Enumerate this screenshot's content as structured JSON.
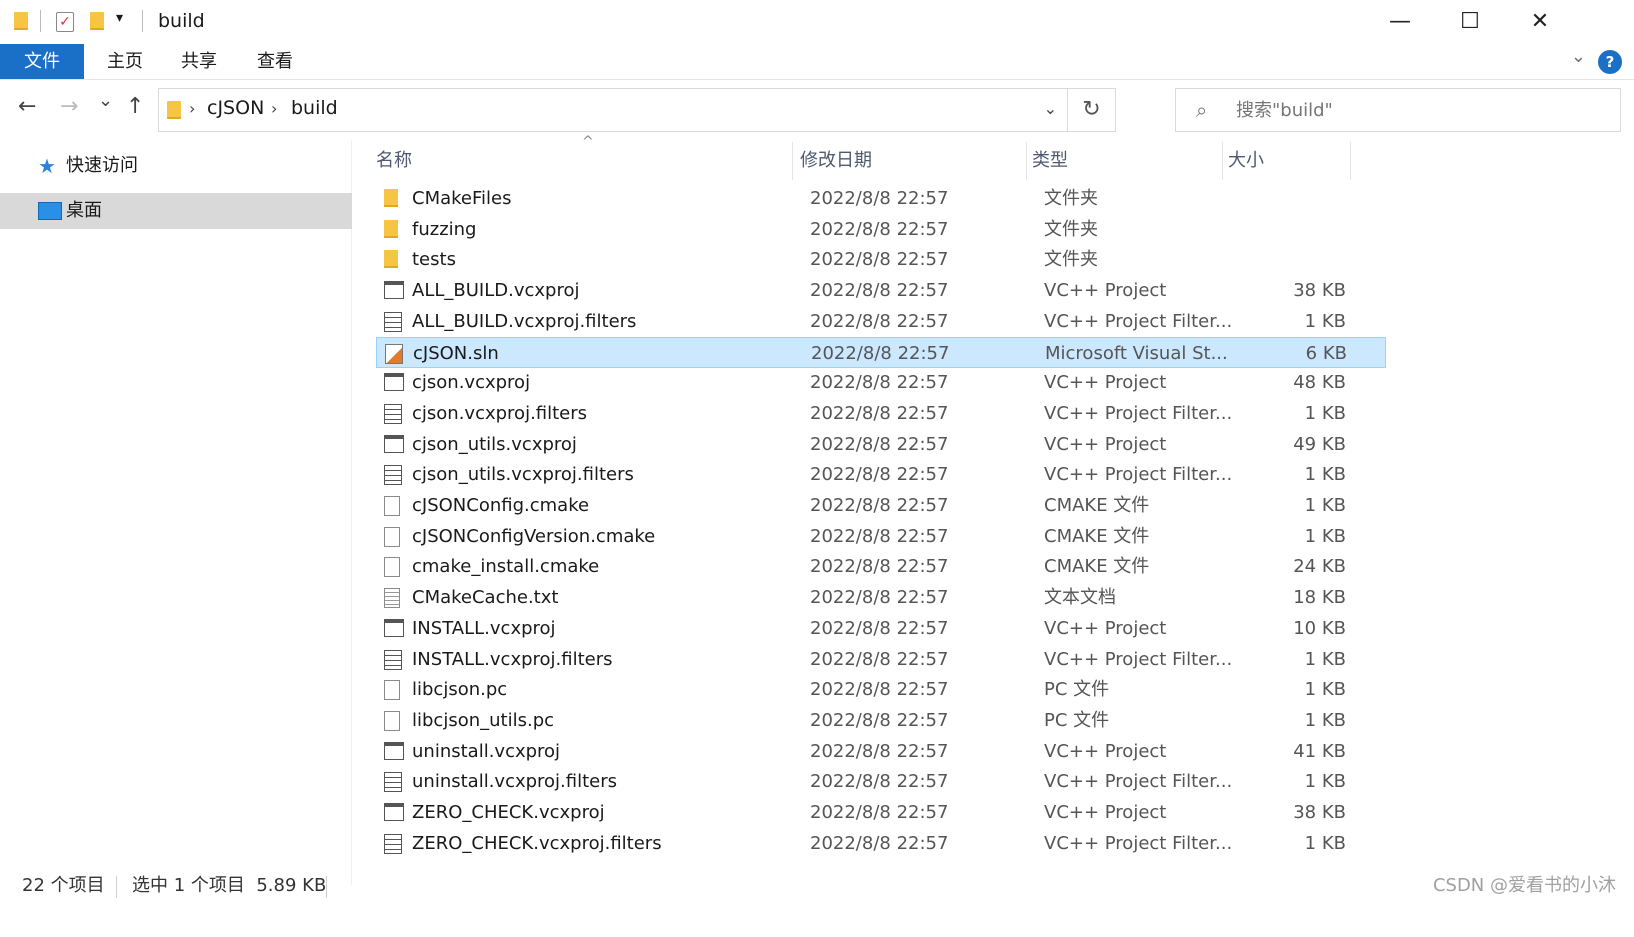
{
  "window": {
    "title": "build",
    "minimize": "—",
    "maximize": "☐",
    "close": "✕"
  },
  "ribbon": {
    "tabs": [
      "文件",
      "主页",
      "共享",
      "查看"
    ],
    "help": "?"
  },
  "nav": {
    "back": "←",
    "forward": "→",
    "recent": "⌄",
    "up": "↑"
  },
  "address": {
    "crumbs": [
      "cJSON",
      "build"
    ]
  },
  "search": {
    "placeholder": "搜索\"build\""
  },
  "sidebar": {
    "items": [
      {
        "label": "快速访问",
        "icon": "star-icon"
      },
      {
        "label": "桌面",
        "icon": "desktop-icon",
        "selected": true
      }
    ]
  },
  "columns": {
    "name": "名称",
    "date": "修改日期",
    "type": "类型",
    "size": "大小"
  },
  "files": [
    {
      "name": "CMakeFiles",
      "date": "2022/8/8 22:57",
      "type": "文件夹",
      "size": "",
      "icon": "folder-icon"
    },
    {
      "name": "fuzzing",
      "date": "2022/8/8 22:57",
      "type": "文件夹",
      "size": "",
      "icon": "folder-icon"
    },
    {
      "name": "tests",
      "date": "2022/8/8 22:57",
      "type": "文件夹",
      "size": "",
      "icon": "folder-icon"
    },
    {
      "name": "ALL_BUILD.vcxproj",
      "date": "2022/8/8 22:57",
      "type": "VC++ Project",
      "size": "38 KB",
      "icon": "vcxproj-icon"
    },
    {
      "name": "ALL_BUILD.vcxproj.filters",
      "date": "2022/8/8 22:57",
      "type": "VC++ Project Filter...",
      "size": "1 KB",
      "icon": "filters-icon"
    },
    {
      "name": "cJSON.sln",
      "date": "2022/8/8 22:57",
      "type": "Microsoft Visual St...",
      "size": "6 KB",
      "icon": "sln-icon",
      "selected": true
    },
    {
      "name": "cjson.vcxproj",
      "date": "2022/8/8 22:57",
      "type": "VC++ Project",
      "size": "48 KB",
      "icon": "vcxproj-icon"
    },
    {
      "name": "cjson.vcxproj.filters",
      "date": "2022/8/8 22:57",
      "type": "VC++ Project Filter...",
      "size": "1 KB",
      "icon": "filters-icon"
    },
    {
      "name": "cjson_utils.vcxproj",
      "date": "2022/8/8 22:57",
      "type": "VC++ Project",
      "size": "49 KB",
      "icon": "vcxproj-icon"
    },
    {
      "name": "cjson_utils.vcxproj.filters",
      "date": "2022/8/8 22:57",
      "type": "VC++ Project Filter...",
      "size": "1 KB",
      "icon": "filters-icon"
    },
    {
      "name": "cJSONConfig.cmake",
      "date": "2022/8/8 22:57",
      "type": "CMAKE 文件",
      "size": "1 KB",
      "icon": "file-icon"
    },
    {
      "name": "cJSONConfigVersion.cmake",
      "date": "2022/8/8 22:57",
      "type": "CMAKE 文件",
      "size": "1 KB",
      "icon": "file-icon"
    },
    {
      "name": "cmake_install.cmake",
      "date": "2022/8/8 22:57",
      "type": "CMAKE 文件",
      "size": "24 KB",
      "icon": "file-icon"
    },
    {
      "name": "CMakeCache.txt",
      "date": "2022/8/8 22:57",
      "type": "文本文档",
      "size": "18 KB",
      "icon": "text-file-icon"
    },
    {
      "name": "INSTALL.vcxproj",
      "date": "2022/8/8 22:57",
      "type": "VC++ Project",
      "size": "10 KB",
      "icon": "vcxproj-icon"
    },
    {
      "name": "INSTALL.vcxproj.filters",
      "date": "2022/8/8 22:57",
      "type": "VC++ Project Filter...",
      "size": "1 KB",
      "icon": "filters-icon"
    },
    {
      "name": "libcjson.pc",
      "date": "2022/8/8 22:57",
      "type": "PC 文件",
      "size": "1 KB",
      "icon": "file-icon"
    },
    {
      "name": "libcjson_utils.pc",
      "date": "2022/8/8 22:57",
      "type": "PC 文件",
      "size": "1 KB",
      "icon": "file-icon"
    },
    {
      "name": "uninstall.vcxproj",
      "date": "2022/8/8 22:57",
      "type": "VC++ Project",
      "size": "41 KB",
      "icon": "vcxproj-icon"
    },
    {
      "name": "uninstall.vcxproj.filters",
      "date": "2022/8/8 22:57",
      "type": "VC++ Project Filter...",
      "size": "1 KB",
      "icon": "filters-icon"
    },
    {
      "name": "ZERO_CHECK.vcxproj",
      "date": "2022/8/8 22:57",
      "type": "VC++ Project",
      "size": "38 KB",
      "icon": "vcxproj-icon"
    },
    {
      "name": "ZERO_CHECK.vcxproj.filters",
      "date": "2022/8/8 22:57",
      "type": "VC++ Project Filter...",
      "size": "1 KB",
      "icon": "filters-icon"
    }
  ],
  "status": {
    "count": "22 个项目",
    "selection": "选中 1 个项目  5.89 KB"
  },
  "watermark": "CSDN @爱看书的小沐",
  "colors": {
    "accent": "#1a6fc7",
    "selection": "#cce8ff",
    "folder": "#f5c543"
  }
}
